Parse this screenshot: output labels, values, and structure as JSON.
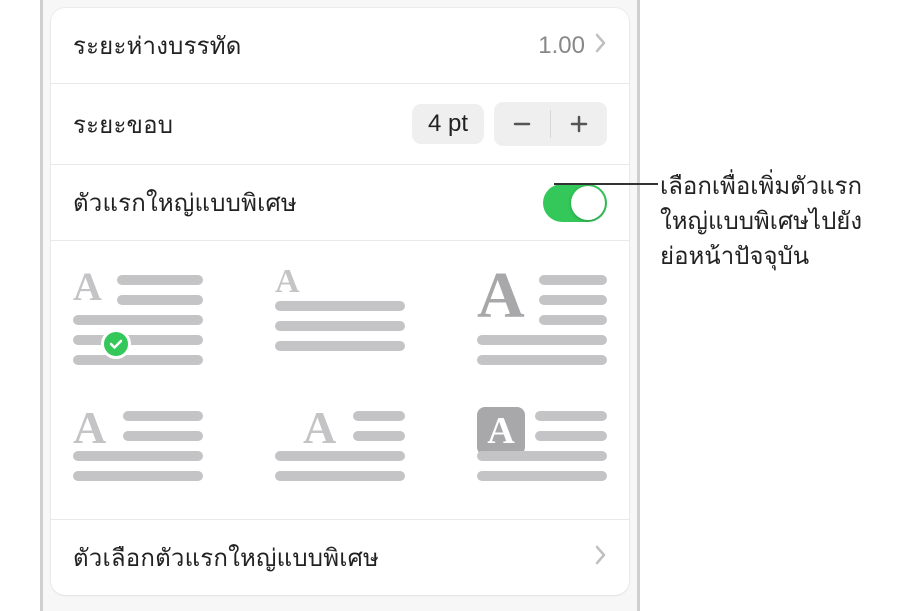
{
  "rows": {
    "lineSpacing": {
      "label": "ระยะห่างบรรทัด",
      "value": "1.00"
    },
    "margin": {
      "label": "ระยะขอบ",
      "value": "4 pt"
    },
    "dropCap": {
      "label": "ตัวแรกใหญ่แบบพิเศษ"
    },
    "options": {
      "label": "ตัวเลือกตัวแรกใหญ่แบบพิเศษ"
    }
  },
  "callout": {
    "line1": "เลือกเพื่อเพิ่มตัวแรก",
    "line2": "ใหญ่แบบพิเศษไปยัง",
    "line3": "ย่อหน้าปัจจุบัน"
  },
  "glyph": "A"
}
